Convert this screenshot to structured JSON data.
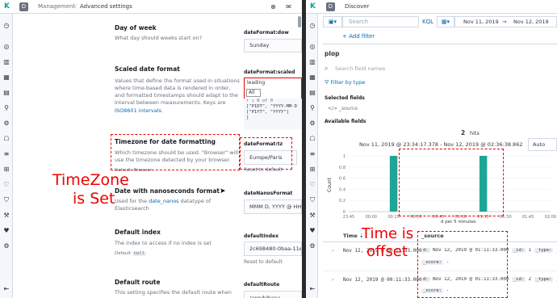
{
  "left": {
    "badge": "D",
    "breadcrumbs": [
      "Management",
      "Advanced settings"
    ],
    "settings": [
      {
        "title": "Day of week",
        "desc": "What day should weeks start on?",
        "key": "dateFormat:dow",
        "value": "Sunday"
      },
      {
        "title": "Scaled date format",
        "desc_lines": [
          "Values that define the format used in situations",
          "where time-based data is rendered in order,",
          "and formatted timestamps should adapt to the",
          "interval between measurements. Keys are"
        ],
        "desc_link": "ISO8601 intervals.",
        "key": "dateFormat:scaled",
        "autocomplete_input": "leading",
        "autocomplete_option": "All",
        "autocomplete_count": "0 of 0",
        "code_lines": [
          "[\"P1DT\", \"YYYY-MM-D",
          "[\"P1YT\", \"YYYY\"]",
          "]"
        ]
      },
      {
        "title": "Timezone for date formatting",
        "desc_lines": [
          "Which timezone should be used. \"Browser\" will",
          "use the timezone detected by your browser."
        ],
        "key": "dateFormat:tz",
        "value": "Europe/Paris",
        "reset": "Reset to default",
        "default_label": "Default:",
        "default_value": "Browser"
      },
      {
        "title": "Date with nanoseconds format",
        "desc_prefix": "Used for the ",
        "desc_link": "date_nanos",
        "desc_suffix": " datatype of",
        "desc_line2": "Elasticsearch",
        "key": "dateNanosFormat",
        "value": "MMM D, YYYY @ HH"
      },
      {
        "title": "Default index",
        "desc": "The index to access if no index is set",
        "key": "defaultIndex",
        "value": "2c698480-0baa-11e",
        "reset": "Reset to default",
        "default_label": "Default",
        "default_value": "null"
      },
      {
        "title": "Default route",
        "desc": "This setting specifies the default route when",
        "key": "defaultRoute",
        "value": "/app/kibana"
      }
    ],
    "annotation": [
      "TimeZone",
      "is Set"
    ]
  },
  "right": {
    "badge": "D",
    "breadcrumb": "Discover",
    "search_placeholder": "Search",
    "kql": "KQL",
    "date_start": "Nov 11, 2019",
    "date_arrow": "→",
    "date_end": "Nov 12, 2019",
    "add_filter": "+ Add filter",
    "index_pattern": "plop",
    "field_search_placeholder": "Search field names",
    "filter_by_type": "Filter by type",
    "selected_fields": "Selected fields",
    "source_field": "_source",
    "available_fields": "Available fields",
    "hits_count": "2",
    "hits_label": "hits",
    "time_range": "Nov 11, 2019 @ 23:34:17.378 - Nov 12, 2019 @ 02:36:38.862",
    "interval": "Auto",
    "xaxis_caption": "d per 5 minutes",
    "col_time": "Time",
    "col_source": "_source",
    "rows": [
      {
        "time": "Nov 12, 2019 @ 00:11:33.000",
        "d": "Nov 12, 2019 @ 01:11:33.000",
        "id_label": "_id:",
        "id": "1",
        "type_label": "_type:",
        "type": "_do",
        "score_label": "_score:",
        "score": "-"
      },
      {
        "time": "Nov 12, 2019 @ 00:11:33.000",
        "d": "Nov 12, 2019 @ 01:11:33.000",
        "id_label": "_id:",
        "id": "2",
        "type_label": "_type:",
        "type": "_do",
        "score_label": "_score:",
        "score": "-"
      }
    ],
    "annotation": [
      "Time is",
      "offset"
    ]
  },
  "chart_data": {
    "type": "bar",
    "title": "",
    "xlabel": "d per 5 minutes",
    "ylabel": "Count",
    "x_ticks": [
      "23:45",
      "00:00",
      "00:15",
      "00:30",
      "00:45",
      "01:00",
      "01:15",
      "01:30",
      "01:45",
      "02:00"
    ],
    "y_ticks": [
      "0",
      "0.2",
      "0.4",
      "0.6",
      "0.8",
      "1"
    ],
    "ylim": [
      0,
      1
    ],
    "categories": [
      "00:15",
      "01:15"
    ],
    "values": [
      1,
      1
    ],
    "bar_color": "#1fa595"
  },
  "colors": {
    "accent": "#006bb4",
    "annotation": "#e00000",
    "bar": "#1fa595"
  }
}
